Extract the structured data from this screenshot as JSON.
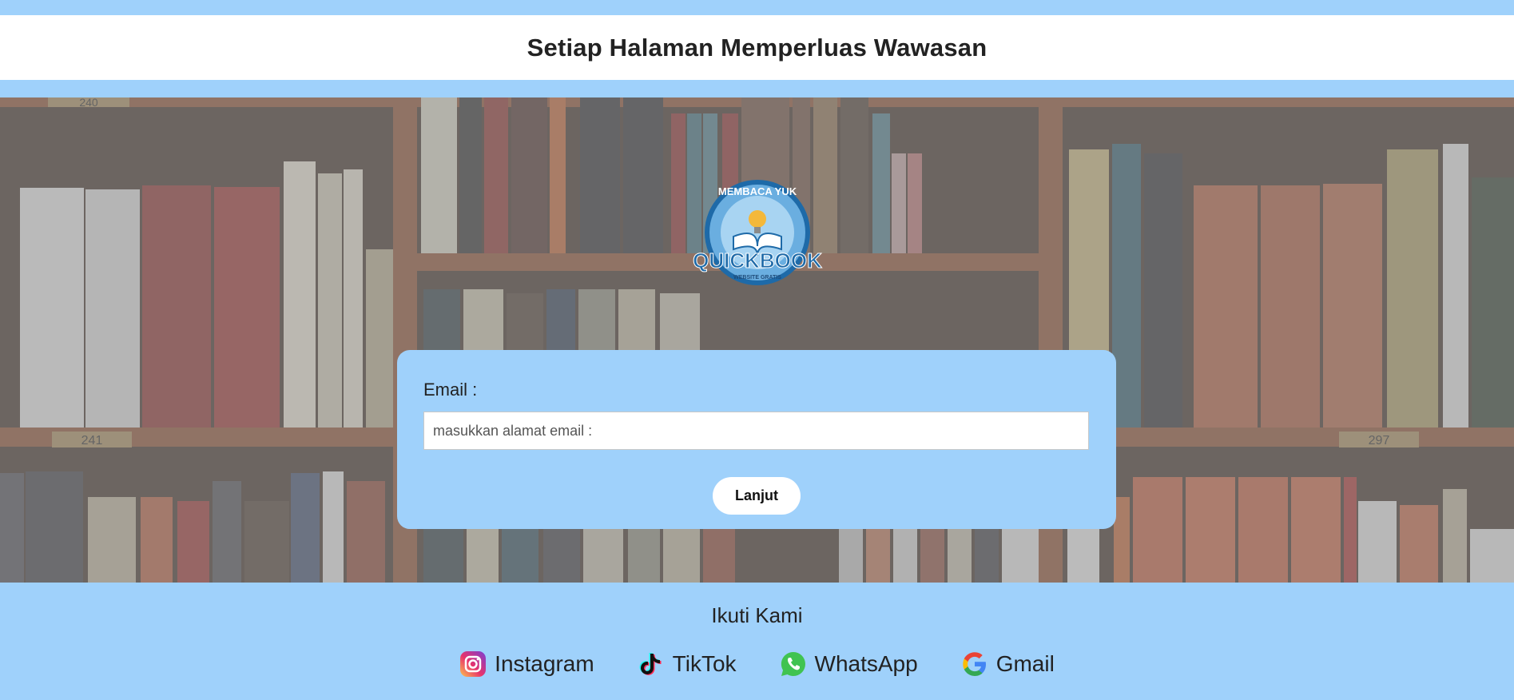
{
  "header": {
    "title": "Setiap Halaman Memperluas Wawasan"
  },
  "logo": {
    "top_text": "MEMBACA YUK",
    "brand": "QUICKBOOK",
    "sub_text": "WEBSITE GRATIS"
  },
  "form": {
    "email_label": "Email :",
    "email_placeholder": "masukkan alamat email :",
    "submit_label": "Lanjut"
  },
  "shelf_labels": [
    "240",
    "241",
    "297"
  ],
  "footer": {
    "follow_label": "Ikuti Kami",
    "links": [
      {
        "label": "Instagram",
        "icon": "instagram-icon"
      },
      {
        "label": "TikTok",
        "icon": "tiktok-icon"
      },
      {
        "label": "WhatsApp",
        "icon": "whatsapp-icon"
      },
      {
        "label": "Gmail",
        "icon": "gmail-icon"
      }
    ]
  },
  "colors": {
    "background": "#9fd1fb",
    "header": "#ffffff",
    "card": "#9fd1fb",
    "button": "#ffffff"
  }
}
